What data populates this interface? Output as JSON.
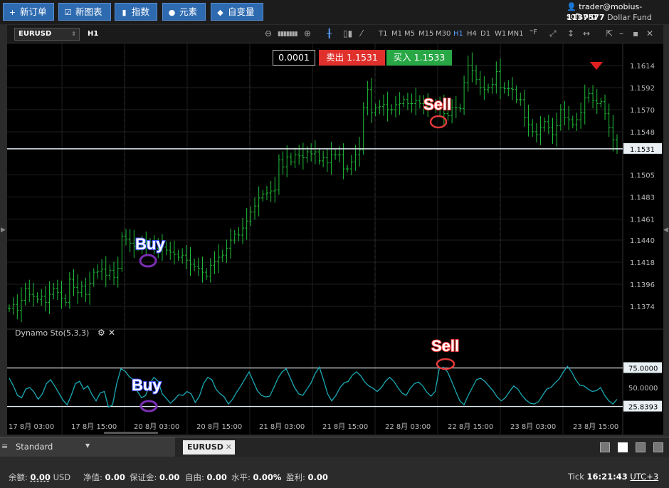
{
  "toolbar": {
    "new_order": "新订单",
    "new_chart": "新图表",
    "indicators": "指数",
    "elements": "元素",
    "variables": "自变量"
  },
  "account": {
    "email": "trader@mobius-soft.org",
    "number": "1137577",
    "name": "Dollar Fund"
  },
  "chart": {
    "symbol": "EURUSD",
    "timeframe": "H1",
    "timeframes": [
      "T1",
      "M1",
      "M5",
      "M15",
      "M30",
      "H1",
      "H4",
      "D1",
      "W1",
      "MN1"
    ],
    "active_timeframe": "H1",
    "lot": "0.0001",
    "sell_label": "卖出 1.1531",
    "buy_label": "买入 1.1533",
    "current_price_label": "1.1531",
    "indicator_title": "Dynamo Sto(5,3,3)",
    "annotations": {
      "buy_main": "Buy",
      "sell_main": "Sell",
      "buy_ind": "Buy",
      "sell_ind": "Sell"
    },
    "colors": {
      "candle": "#1fbf3a",
      "indicator": "#1aa9b3",
      "sell_q": "#e0302c",
      "buy_q": "#28a745",
      "buy_annot": "#4055ff",
      "sell_annot": "#ff3b3b"
    }
  },
  "chart_data": {
    "type": "candlestick",
    "symbol": "EURUSD",
    "timeframe": "H1",
    "y_ticks": [
      "1.1614",
      "1.1592",
      "1.1570",
      "1.1548",
      "1.1505",
      "1.1483",
      "1.1461",
      "1.1440",
      "1.1418",
      "1.1396",
      "1.1374"
    ],
    "ylim": [
      1.1352,
      1.1636
    ],
    "current_price": 1.1531,
    "x_ticks": [
      "17 8月 03:00",
      "17 8月 15:00",
      "20 8月 03:00",
      "20 8月 15:00",
      "21 8月 03:00",
      "21 8月 15:00",
      "22 8月 03:00",
      "22 8月 15:00",
      "23 8月 03:00",
      "23 8月 15:00"
    ],
    "closes": [
      1.1372,
      1.1376,
      1.137,
      1.138,
      1.1392,
      1.1386,
      1.1384,
      1.1381,
      1.1384,
      1.1378,
      1.1386,
      1.1392,
      1.1388,
      1.1382,
      1.1378,
      1.1401,
      1.1393,
      1.1388,
      1.1394,
      1.1386,
      1.1397,
      1.1408,
      1.1409,
      1.1411,
      1.1405,
      1.141,
      1.1403,
      1.1412,
      1.1444,
      1.1441,
      1.1437,
      1.1434,
      1.1434,
      1.1436,
      1.1437,
      1.1438,
      1.1432,
      1.1431,
      1.1433,
      1.143,
      1.1428,
      1.1426,
      1.1423,
      1.1425,
      1.142,
      1.1416,
      1.1414,
      1.1412,
      1.1408,
      1.1404,
      1.1415,
      1.1419,
      1.1423,
      1.1425,
      1.1432,
      1.144,
      1.1446,
      1.1445,
      1.1452,
      1.1459,
      1.1468,
      1.1474,
      1.1482,
      1.1486,
      1.1487,
      1.1489,
      1.149,
      1.152,
      1.1513,
      1.1523,
      1.1518,
      1.1525,
      1.1524,
      1.1522,
      1.1528,
      1.1526,
      1.1528,
      1.1519,
      1.1522,
      1.1517,
      1.1525,
      1.1525,
      1.1525,
      1.1511,
      1.1511,
      1.1518,
      1.1525,
      1.153,
      1.1572,
      1.159,
      1.1567,
      1.1572,
      1.1573,
      1.1575,
      1.157,
      1.157,
      1.1575,
      1.1576,
      1.158,
      1.1576,
      1.1576,
      1.1579,
      1.1576,
      1.1573,
      1.1575,
      1.1574,
      1.1573,
      1.1572,
      1.1566,
      1.1564,
      1.1572,
      1.1572,
      1.1571,
      1.1597,
      1.1614,
      1.1609,
      1.16,
      1.1592,
      1.159,
      1.1592,
      1.1595,
      1.1608,
      1.1592,
      1.1591,
      1.1591,
      1.159,
      1.158,
      1.158,
      1.1562,
      1.1555,
      1.1548,
      1.1545,
      1.1552,
      1.1558,
      1.1552,
      1.1545,
      1.1554,
      1.157,
      1.1562,
      1.156,
      1.1555,
      1.156,
      1.1567,
      1.1582,
      1.1586,
      1.1579,
      1.1576,
      1.1578,
      1.1566,
      1.1552,
      1.154,
      1.1531
    ],
    "indicator": {
      "name": "Dynamo Sto(5,3,3)",
      "levels": [
        75.0,
        25.8393
      ],
      "y_ticks": [
        "75.0000",
        "50.0000",
        "25.8393"
      ],
      "values": [
        62,
        52,
        40,
        37,
        48,
        50,
        44,
        35,
        42,
        55,
        60,
        52,
        43,
        34,
        28,
        40,
        55,
        58,
        48,
        52,
        41,
        33,
        43,
        45,
        25,
        28,
        55,
        74,
        71,
        64,
        60,
        45,
        37,
        40,
        55,
        63,
        58,
        42,
        36,
        30,
        35,
        41,
        40,
        45,
        42,
        31,
        39,
        55,
        63,
        60,
        48,
        42,
        38,
        29,
        35,
        44,
        52,
        61,
        70,
        58,
        46,
        40,
        38,
        39,
        50,
        62,
        70,
        74,
        62,
        50,
        42,
        40,
        48,
        56,
        68,
        76,
        60,
        42,
        33,
        40,
        50,
        56,
        58,
        66,
        70,
        65,
        57,
        52,
        49,
        45,
        50,
        58,
        63,
        58,
        50,
        43,
        40,
        49,
        55,
        57,
        52,
        44,
        39,
        45,
        74,
        76,
        70,
        58,
        45,
        33,
        28,
        40,
        50,
        60,
        62,
        58,
        52,
        46,
        38,
        33,
        37,
        45,
        52,
        48,
        40,
        34,
        30,
        29,
        32,
        40,
        48,
        50,
        56,
        61,
        70,
        77,
        70,
        60,
        53,
        52,
        48,
        45,
        46,
        50,
        40,
        33,
        29,
        35
      ]
    }
  },
  "tabs": {
    "workspace": "Standard",
    "open_tab": "EURUSD"
  },
  "status": {
    "balance_label": "余额:",
    "balance_value": "0.00",
    "currency": "USD",
    "equity_label": "净值:",
    "equity_value": "0.00",
    "margin_label": "保证金:",
    "margin_value": "0.00",
    "free_label": "自由:",
    "free_value": "0.00",
    "level_label": "水平:",
    "level_value": "0.00%",
    "pl_label": "盈利:",
    "pl_value": "0.00",
    "tick_label": "Tick",
    "time": "16:21:43",
    "tz": "UTC+3"
  }
}
